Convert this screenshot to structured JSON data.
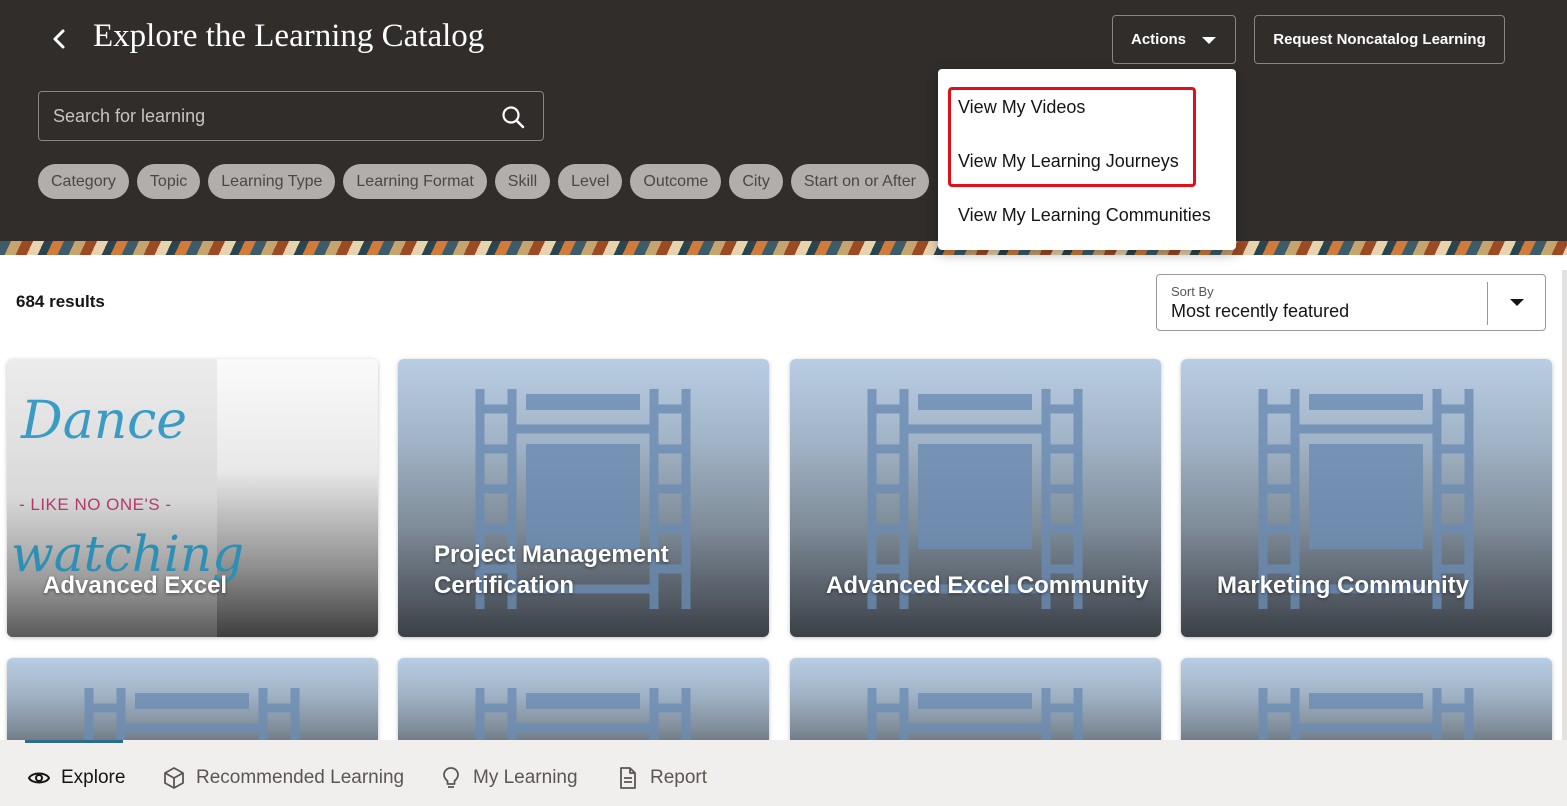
{
  "header": {
    "title": "Explore the Learning Catalog",
    "back_icon": "chevron-left-icon",
    "actions_label": "Actions",
    "request_label": "Request Noncatalog Learning",
    "search_placeholder": "Search for learning",
    "filters": [
      "Category",
      "Topic",
      "Learning Type",
      "Learning Format",
      "Skill",
      "Level",
      "Outcome",
      "City",
      "Start on or After"
    ]
  },
  "actions_menu": {
    "items": [
      "View My Videos",
      "View My Learning Journeys",
      "View My Learning Communities"
    ],
    "highlight_color": "#e0101a"
  },
  "results": {
    "count": "684 results",
    "sort_label": "Sort By",
    "sort_value": "Most recently featured"
  },
  "cards": [
    {
      "title": "Advanced Excel",
      "image": "dance-like-no-ones-watching",
      "art_word1": "Dance",
      "art_sub": "- LIKE NO ONE'S -",
      "art_word2": "watching"
    },
    {
      "title_line1": "Project Management",
      "title_line2": "Certification",
      "image": "film-strip-icon"
    },
    {
      "title": "Advanced Excel Community",
      "image": "film-strip-icon"
    },
    {
      "title": "Marketing Community",
      "image": "film-strip-icon"
    }
  ],
  "bottom_nav": {
    "items": [
      {
        "label": "Explore",
        "icon": "eye-icon",
        "active": true
      },
      {
        "label": "Recommended Learning",
        "icon": "cube-icon",
        "active": false
      },
      {
        "label": "My Learning",
        "icon": "lightbulb-icon",
        "active": false
      },
      {
        "label": "Report",
        "icon": "document-icon",
        "active": false
      }
    ],
    "accent": "#2b6c8a"
  },
  "colors": {
    "header_bg": "#312d2a",
    "chip_bg": "#b1aeab"
  }
}
